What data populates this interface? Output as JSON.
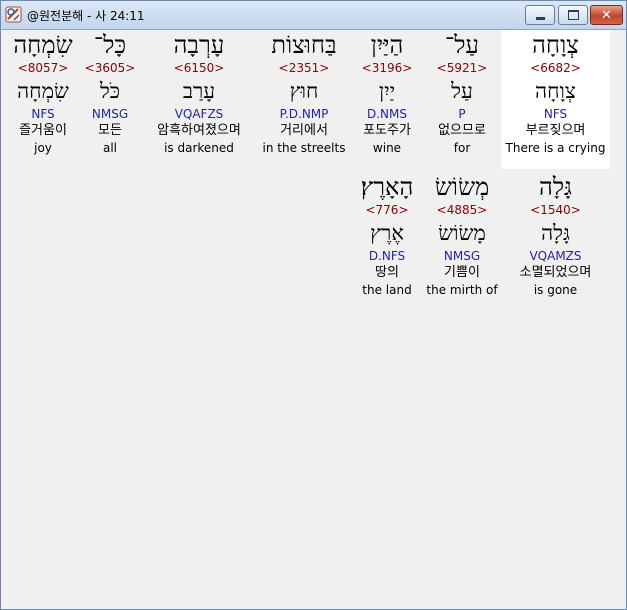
{
  "window": {
    "title": "@원전분해 - 사 24:11",
    "icon": "app-icon",
    "buttons": {
      "minimize": "minimize",
      "maximize": "maximize",
      "close": "✕"
    }
  },
  "words": [
    {
      "hebrew": "צְוָחָה",
      "strong": "<6682>",
      "lemma": "צְוָחָה",
      "parse": "NFS",
      "korean": "부르짖으며",
      "english": "There is a crying",
      "highlighted": true
    },
    {
      "hebrew": "עַל־",
      "strong": "<5921>",
      "lemma": "עַל",
      "parse": "P",
      "korean": "없으므로",
      "english": "for"
    },
    {
      "hebrew": "הַיַּיִן",
      "strong": "<3196>",
      "lemma": "יַיִן",
      "parse": "D.NMS",
      "korean": "포도주가",
      "english": "wine"
    },
    {
      "hebrew": "בַּחוּצוֹת",
      "strong": "<2351>",
      "lemma": "חוּץ",
      "parse": "P.D.NMP",
      "korean": "거리에서",
      "english": "in the streelts"
    },
    {
      "hebrew": "עָרְבָה",
      "strong": "<6150>",
      "lemma": "עָרַב",
      "parse": "VQAFZS",
      "korean": "암흑하여졌으며",
      "english": "is darkened"
    },
    {
      "hebrew": "כָּל־",
      "strong": "<3605>",
      "lemma": "כֹּל",
      "parse": "NMSG",
      "korean": "모든",
      "english": "all"
    },
    {
      "hebrew": "שִׂמְחָה",
      "strong": "<8057>",
      "lemma": "שִׂמְחָה",
      "parse": "NFS",
      "korean": "즐거움이",
      "english": "joy"
    },
    {
      "hebrew": "גָּלָה",
      "strong": "<1540>",
      "lemma": "גָּלָה",
      "parse": "VQAMZS",
      "korean": "소멸되었으며",
      "english": "is gone"
    },
    {
      "hebrew": "מְשׂוֹשׂ",
      "strong": "<4885>",
      "lemma": "מָשׂוֹשׂ",
      "parse": "NMSG",
      "korean": "기쁨이",
      "english": "the mirth of"
    },
    {
      "hebrew": "הָאָרֶץ׃",
      "strong": "<776>",
      "lemma": "אֶרֶץ",
      "parse": "D.NFS",
      "korean": "땅의",
      "english": "the land"
    }
  ]
}
